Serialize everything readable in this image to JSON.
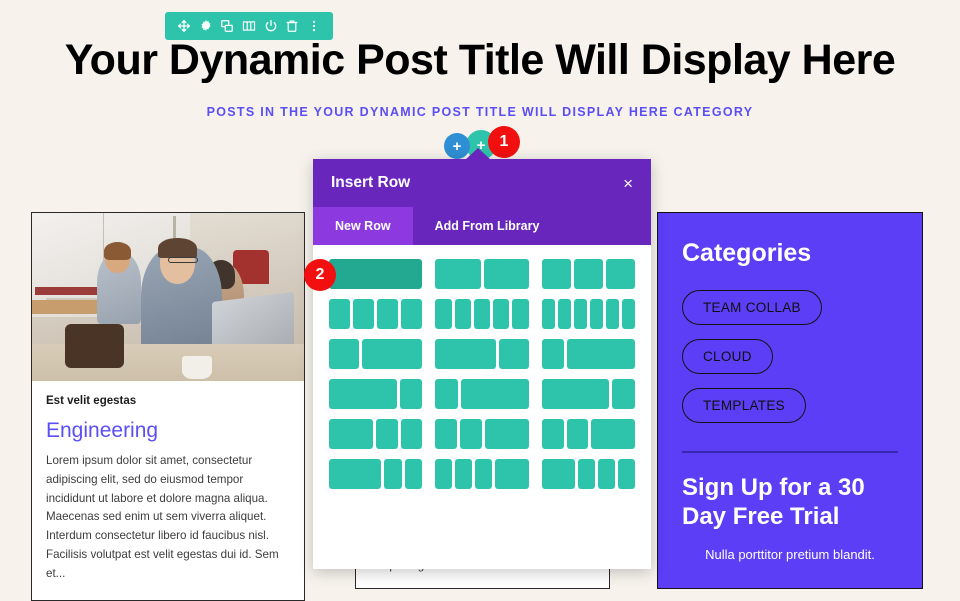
{
  "page": {
    "background_color": "#f7f2ec",
    "title": "Your Dynamic Post Title Will Display Here",
    "subtitle": "POSTS IN THE YOUR DYNAMIC POST TITLE WILL DISPLAY HERE CATEGORY",
    "title_color": "#000000",
    "subtitle_color": "#5b4ef5"
  },
  "module_toolbar": {
    "background_color": "#2ec4ab",
    "icons": [
      {
        "name": "move-icon",
        "label": "Move"
      },
      {
        "name": "gear-icon",
        "label": "Settings"
      },
      {
        "name": "duplicate-icon",
        "label": "Duplicate"
      },
      {
        "name": "columns-icon",
        "label": "Columns"
      },
      {
        "name": "power-icon",
        "label": "Disable"
      },
      {
        "name": "trash-icon",
        "label": "Delete"
      },
      {
        "name": "more-options-icon",
        "label": "More Options"
      }
    ]
  },
  "add_controls": {
    "add_module_label": "+",
    "add_row_label": "+",
    "badge_1": "1",
    "badge_2": "2",
    "badge_color": "#f20f0f",
    "add_module_color": "#2f8fd4",
    "add_row_color": "#2ec4ab"
  },
  "modal": {
    "title": "Insert Row",
    "close_label": "×",
    "header_color": "#6826bd",
    "active_tab_color": "#8c3ae0",
    "tabs": [
      {
        "label": "New Row",
        "active": true
      },
      {
        "label": "Add From Library",
        "active": false
      }
    ],
    "column_color": "#2ec4ab",
    "column_hover_color": "#23a891",
    "layouts": [
      {
        "name": "layout-1-col",
        "ratios": [
          1
        ],
        "hovered": true
      },
      {
        "name": "layout-2-col",
        "ratios": [
          1,
          1
        ],
        "hovered": false
      },
      {
        "name": "layout-3-col",
        "ratios": [
          1,
          1,
          1
        ],
        "hovered": false
      },
      {
        "name": "layout-4-col",
        "ratios": [
          1,
          1,
          1,
          1
        ],
        "hovered": false
      },
      {
        "name": "layout-5-col",
        "ratios": [
          1,
          1,
          1,
          1,
          1
        ],
        "hovered": false
      },
      {
        "name": "layout-6-col",
        "ratios": [
          1,
          1,
          1,
          1,
          1,
          1
        ],
        "hovered": false
      },
      {
        "name": "layout-1-2",
        "ratios": [
          1,
          2
        ],
        "hovered": false
      },
      {
        "name": "layout-2-1",
        "ratios": [
          2,
          1
        ],
        "hovered": false
      },
      {
        "name": "layout-1-3",
        "ratios": [
          1,
          3
        ],
        "hovered": false
      },
      {
        "name": "layout-3-1",
        "ratios": [
          3,
          1
        ],
        "hovered": false
      },
      {
        "name": "layout-1-3b",
        "ratios": [
          1,
          3
        ],
        "hovered": false
      },
      {
        "name": "layout-3-1b",
        "ratios": [
          3,
          1
        ],
        "hovered": false
      },
      {
        "name": "layout-2-1-1",
        "ratios": [
          2,
          1,
          1
        ],
        "hovered": false
      },
      {
        "name": "layout-1-1-2",
        "ratios": [
          1,
          1,
          2
        ],
        "hovered": false
      },
      {
        "name": "layout-1-1-2b",
        "ratios": [
          1,
          1,
          2
        ],
        "hovered": false
      },
      {
        "name": "layout-3-1-1",
        "ratios": [
          3,
          1,
          1
        ],
        "hovered": false
      },
      {
        "name": "layout-1-1-1-2",
        "ratios": [
          1,
          1,
          1,
          2
        ],
        "hovered": false
      },
      {
        "name": "layout-2-1-1-1",
        "ratios": [
          2,
          1,
          1,
          1
        ],
        "hovered": false
      }
    ]
  },
  "post_card": {
    "meta": "Est velit egestas",
    "heading": "Engineering",
    "heading_color": "#5b4ef5",
    "excerpt": "Lorem ipsum dolor sit amet, consectetur adipiscing elit, sed do eiusmod tempor incididunt ut labore et dolore magna aliqua. Maecenas sed enim ut sem viverra aliquet. Interdum consectetur libero id faucibus nisl. Facilisis volutpat est velit egestas dui id. Sem et...",
    "image_alt": "man working on laptop in a cafe"
  },
  "post_card_mid": {
    "excerpt_tail": "tempus egestas sed sed..."
  },
  "sidebar": {
    "background_color": "#5b3ef5",
    "categories_title": "Categories",
    "categories": [
      {
        "label": "TEAM COLLAB"
      },
      {
        "label": "CLOUD"
      },
      {
        "label": "TEMPLATES"
      }
    ],
    "signup_title": "Sign Up for a 30 Day Free Trial",
    "signup_sub": "Nulla porttitor pretium blandit."
  }
}
